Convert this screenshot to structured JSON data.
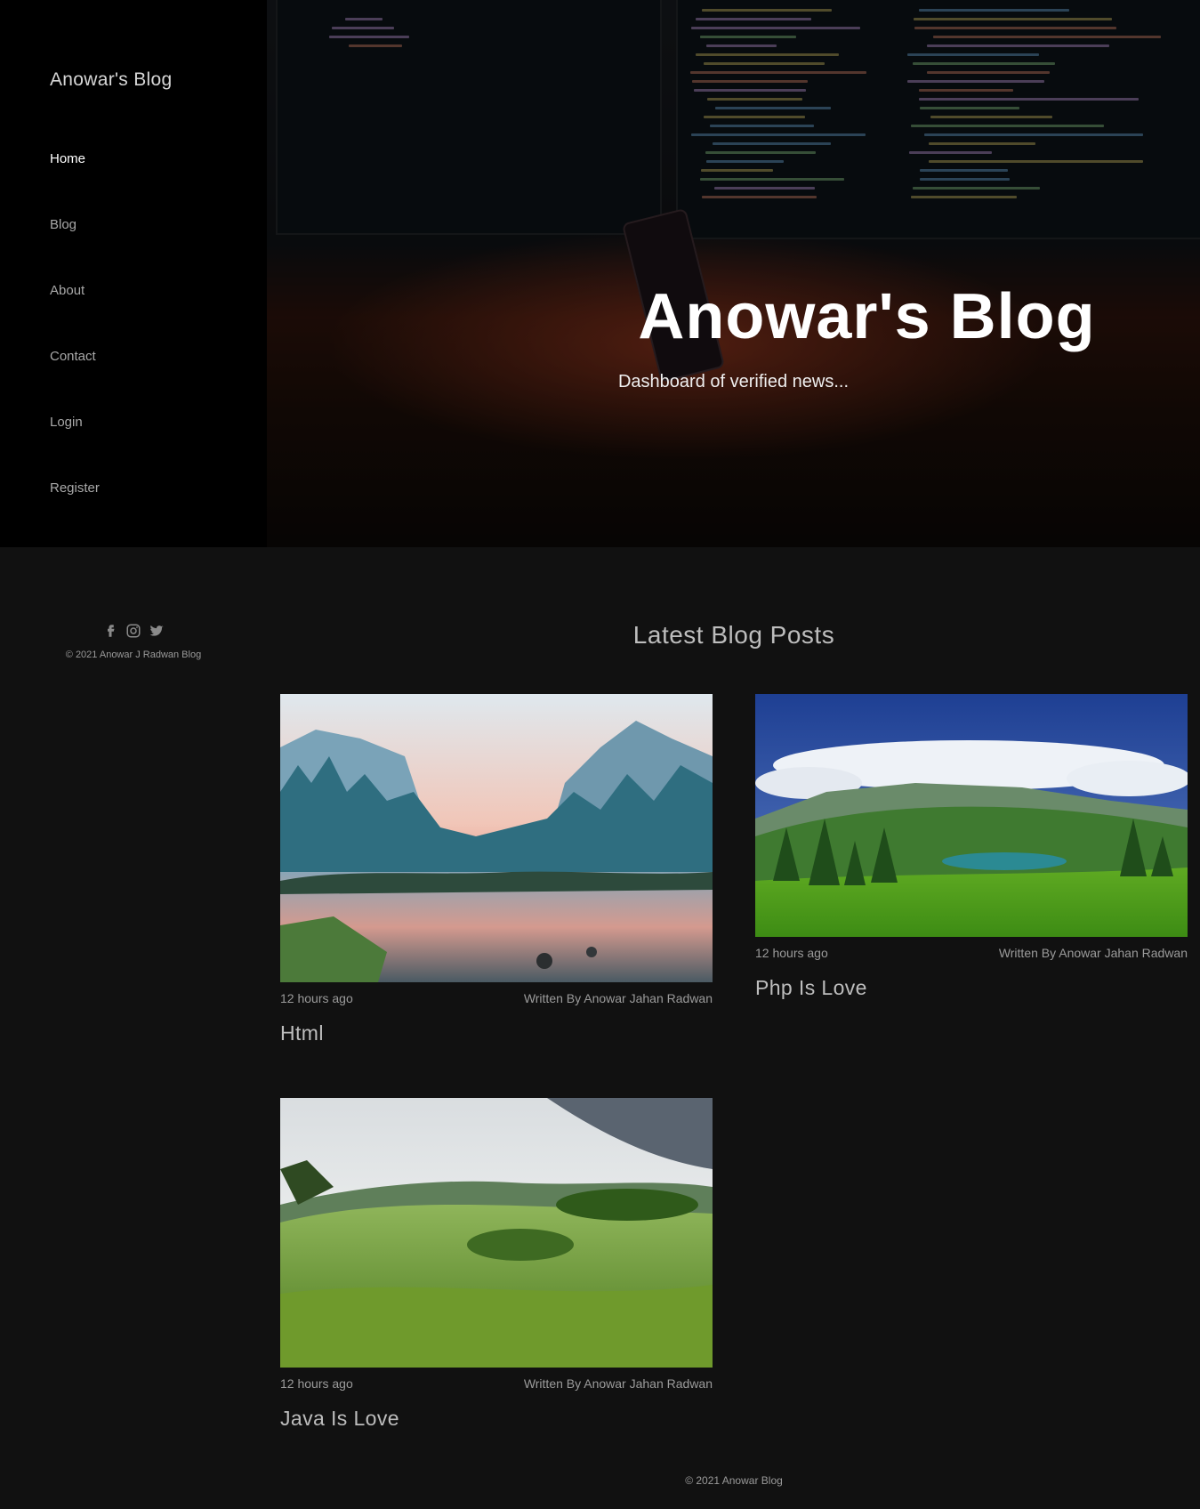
{
  "sidebar": {
    "brand": "Anowar's Blog",
    "nav": [
      {
        "label": "Home",
        "active": true
      },
      {
        "label": "Blog"
      },
      {
        "label": "About"
      },
      {
        "label": "Contact"
      },
      {
        "label": "Login"
      },
      {
        "label": "Register"
      }
    ],
    "social_icons": [
      "facebook-icon",
      "instagram-icon",
      "twitter-icon"
    ],
    "copyright": "© 2021 Anowar J Radwan Blog"
  },
  "hero": {
    "title": "Anowar's Blog",
    "subtitle": "Dashboard of verified news..."
  },
  "main": {
    "section_title": "Latest Blog Posts",
    "posts": [
      {
        "time": "12 hours ago",
        "author": "Written By Anowar Jahan Radwan",
        "title": "Html",
        "image": "mountain-lake-sunset"
      },
      {
        "time": "12 hours ago",
        "author": "Written By Anowar Jahan Radwan",
        "title": "Php Is Love",
        "image": "green-valley-lake"
      },
      {
        "time": "12 hours ago",
        "author": "Written By Anowar Jahan Radwan",
        "title": "Java Is Love",
        "image": "rolling-green-hills"
      }
    ]
  },
  "footer": {
    "copyright": "© 2021 Anowar Blog"
  },
  "colors": {
    "page_bg": "#111111",
    "sidebar_bg": "#000000",
    "text_muted": "#9b9b9b",
    "heading": "#bdbdbd"
  }
}
